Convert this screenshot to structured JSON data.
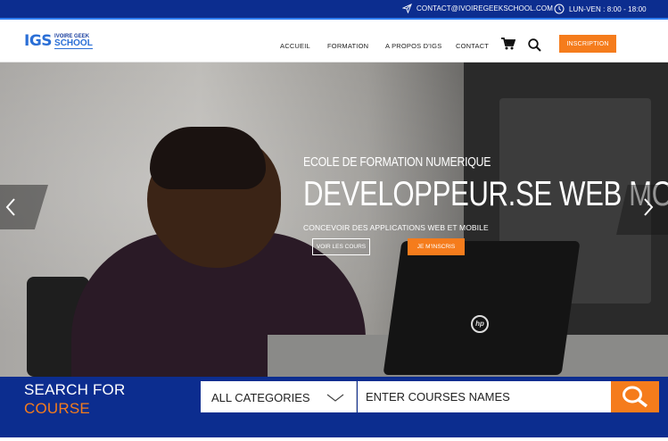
{
  "topbar": {
    "contact": "CONTACT@IVOIREGEEKSCHOOL.COM",
    "hours": "LUN-VEN :  8:00 - 18:00",
    "contact_icon": "paper-plane-icon",
    "hours_icon": "clock-icon"
  },
  "header": {
    "logo_main": "IGS",
    "logo_line1": "IVOIRE GEEK",
    "logo_line2": "SCHOOL",
    "nav": [
      "ACCUEIL",
      "FORMATION",
      "A PROPOS D'IGS",
      "CONTACT"
    ],
    "cart_icon": "cart-icon",
    "search_icon": "search-icon",
    "cta": "INSCRIPTION"
  },
  "hero": {
    "subtitle": "ECOLE DE FORMATION NUMERIQUE",
    "title": "DEVELOPPEUR.SE WEB MOBILE",
    "description": "CONCEVOIR DES APPLICATIONS WEB ET MOBILE",
    "btn_courses": "VOIR LES COURS",
    "btn_register": "JE M'INSCRIS",
    "laptop_logo": "hp",
    "prev_icon": "chevron-left-icon",
    "next_icon": "chevron-right-icon"
  },
  "search": {
    "title_white": "SEARCH FOR",
    "title_orange": "COURSE",
    "category": "ALL CATEGORIES",
    "placeholder": "ENTER COURSES NAMES",
    "button_icon": "search-icon"
  },
  "colors": {
    "navy": "#0c2d8f",
    "orange": "#f57c1c",
    "accent_blue": "#2b6fd6"
  }
}
